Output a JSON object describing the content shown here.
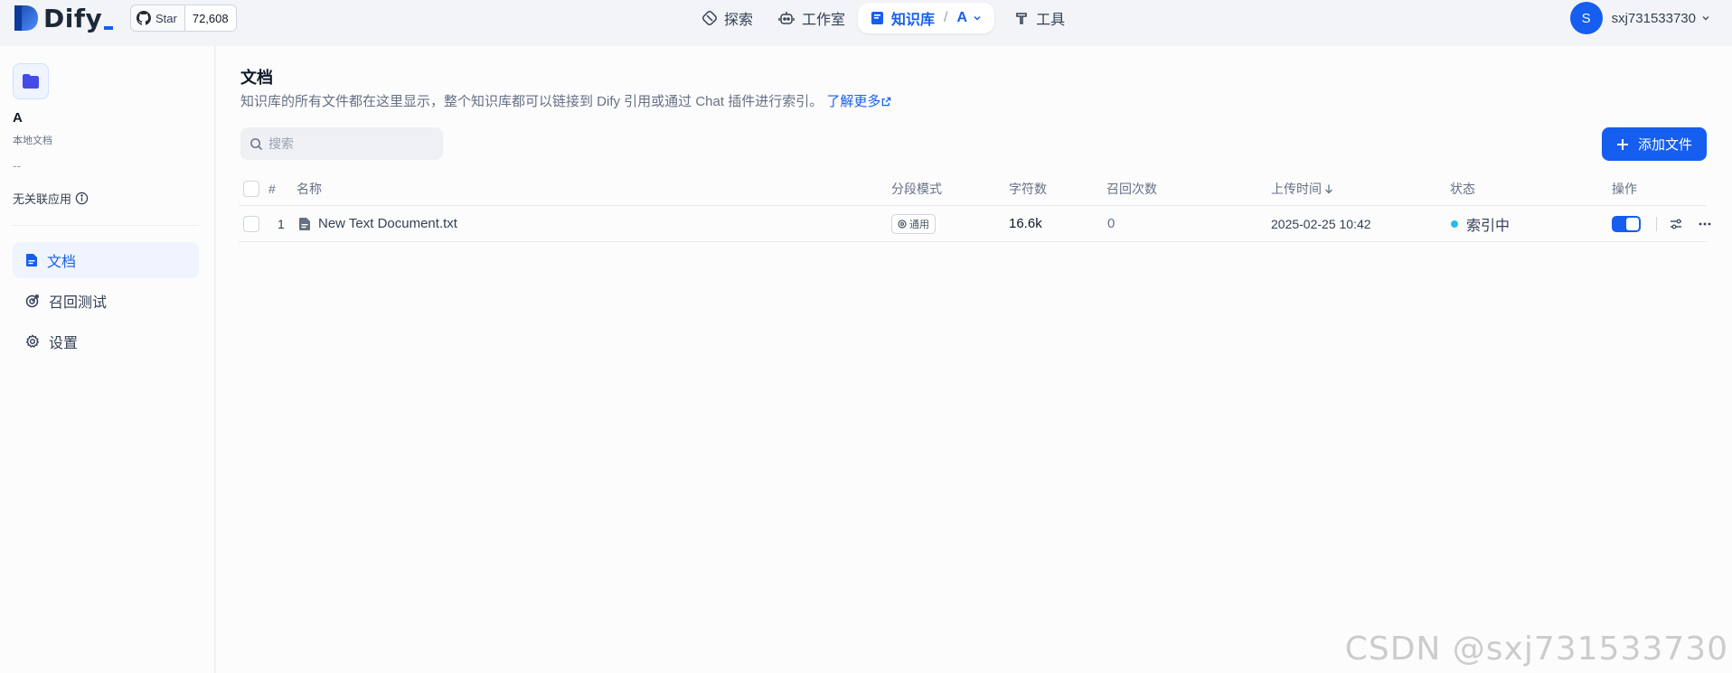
{
  "header": {
    "logo_text": "Dify",
    "github": {
      "star_label": "Star",
      "star_count": "72,608"
    },
    "nav": [
      {
        "label": "探索",
        "icon": "explore-icon"
      },
      {
        "label": "工作室",
        "icon": "robot-icon"
      },
      {
        "label": "知识库",
        "icon": "book-icon",
        "active": true,
        "dataset": "A"
      },
      {
        "label": "工具",
        "icon": "hammer-icon"
      }
    ],
    "account": {
      "avatar_initial": "S",
      "name": "sxj731533730"
    }
  },
  "sidebar": {
    "dataset_name": "A",
    "dataset_type": "本地文档",
    "dataset_desc": "--",
    "linked_apps": "无关联应用",
    "items": [
      {
        "label": "文档",
        "icon": "document-icon",
        "active": true
      },
      {
        "label": "召回测试",
        "icon": "target-icon"
      },
      {
        "label": "设置",
        "icon": "gear-icon"
      }
    ]
  },
  "main": {
    "title": "文档",
    "description": "知识库的所有文件都在这里显示，整个知识库都可以链接到 Dify 引用或通过 Chat 插件进行索引。",
    "learn_more": "了解更多",
    "search_placeholder": "搜索",
    "add_button": "添加文件",
    "table": {
      "columns": {
        "index": "#",
        "name": "名称",
        "mode": "分段模式",
        "chars": "字符数",
        "hits": "召回次数",
        "uploaded": "上传时间",
        "status": "状态",
        "actions": "操作"
      },
      "rows": [
        {
          "index": "1",
          "name": "New Text Document.txt",
          "mode": "通用",
          "chars": "16.6k",
          "hits": "0",
          "uploaded": "2025-02-25 10:42",
          "status": "索引中",
          "enabled": true
        }
      ]
    }
  },
  "watermark": "CSDN @sxj731533730",
  "colors": {
    "primary": "#155eef",
    "status_indexing": "#1fc0f0"
  }
}
